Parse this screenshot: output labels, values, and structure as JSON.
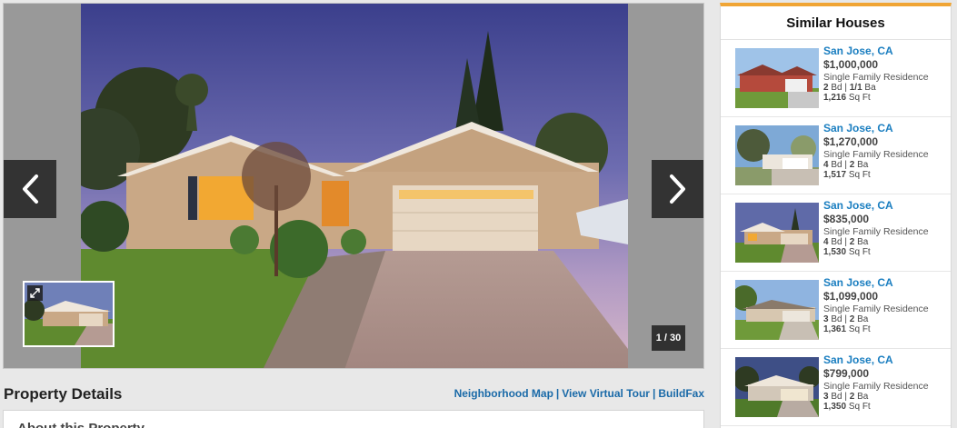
{
  "gallery": {
    "counter": "1 / 30",
    "prev_icon": "chevron-left-icon",
    "next_icon": "chevron-right-icon",
    "expand_icon": "expand-icon"
  },
  "details": {
    "title": "Property Details",
    "links": [
      "Neighborhood Map",
      "View Virtual Tour",
      "BuildFax"
    ],
    "about_title": "About this Property"
  },
  "similar": {
    "title": "Similar Houses",
    "items": [
      {
        "city": "San Jose, CA",
        "price": "$1,000,000",
        "type": "Single Family Residence",
        "bd": "2",
        "bd_label": "Bd",
        "ba": "1/1",
        "ba_label": "Ba",
        "sqft": "1,216",
        "sqft_label": "Sq Ft"
      },
      {
        "city": "San Jose, CA",
        "price": "$1,270,000",
        "type": "Single Family Residence",
        "bd": "4",
        "bd_label": "Bd",
        "ba": "2",
        "ba_label": "Ba",
        "sqft": "1,517",
        "sqft_label": "Sq Ft"
      },
      {
        "city": "San Jose, CA",
        "price": "$835,000",
        "type": "Single Family Residence",
        "bd": "4",
        "bd_label": "Bd",
        "ba": "2",
        "ba_label": "Ba",
        "sqft": "1,530",
        "sqft_label": "Sq Ft"
      },
      {
        "city": "San Jose, CA",
        "price": "$1,099,000",
        "type": "Single Family Residence",
        "bd": "3",
        "bd_label": "Bd",
        "ba": "2",
        "ba_label": "Ba",
        "sqft": "1,361",
        "sqft_label": "Sq Ft"
      },
      {
        "city": "San Jose, CA",
        "price": "$799,000",
        "type": "Single Family Residence",
        "bd": "3",
        "bd_label": "Bd",
        "ba": "2",
        "ba_label": "Ba",
        "sqft": "1,350",
        "sqft_label": "Sq Ft"
      }
    ]
  },
  "colors": {
    "accent": "#f0a535",
    "link": "#1a6aa8",
    "city": "#1a7ec0"
  }
}
